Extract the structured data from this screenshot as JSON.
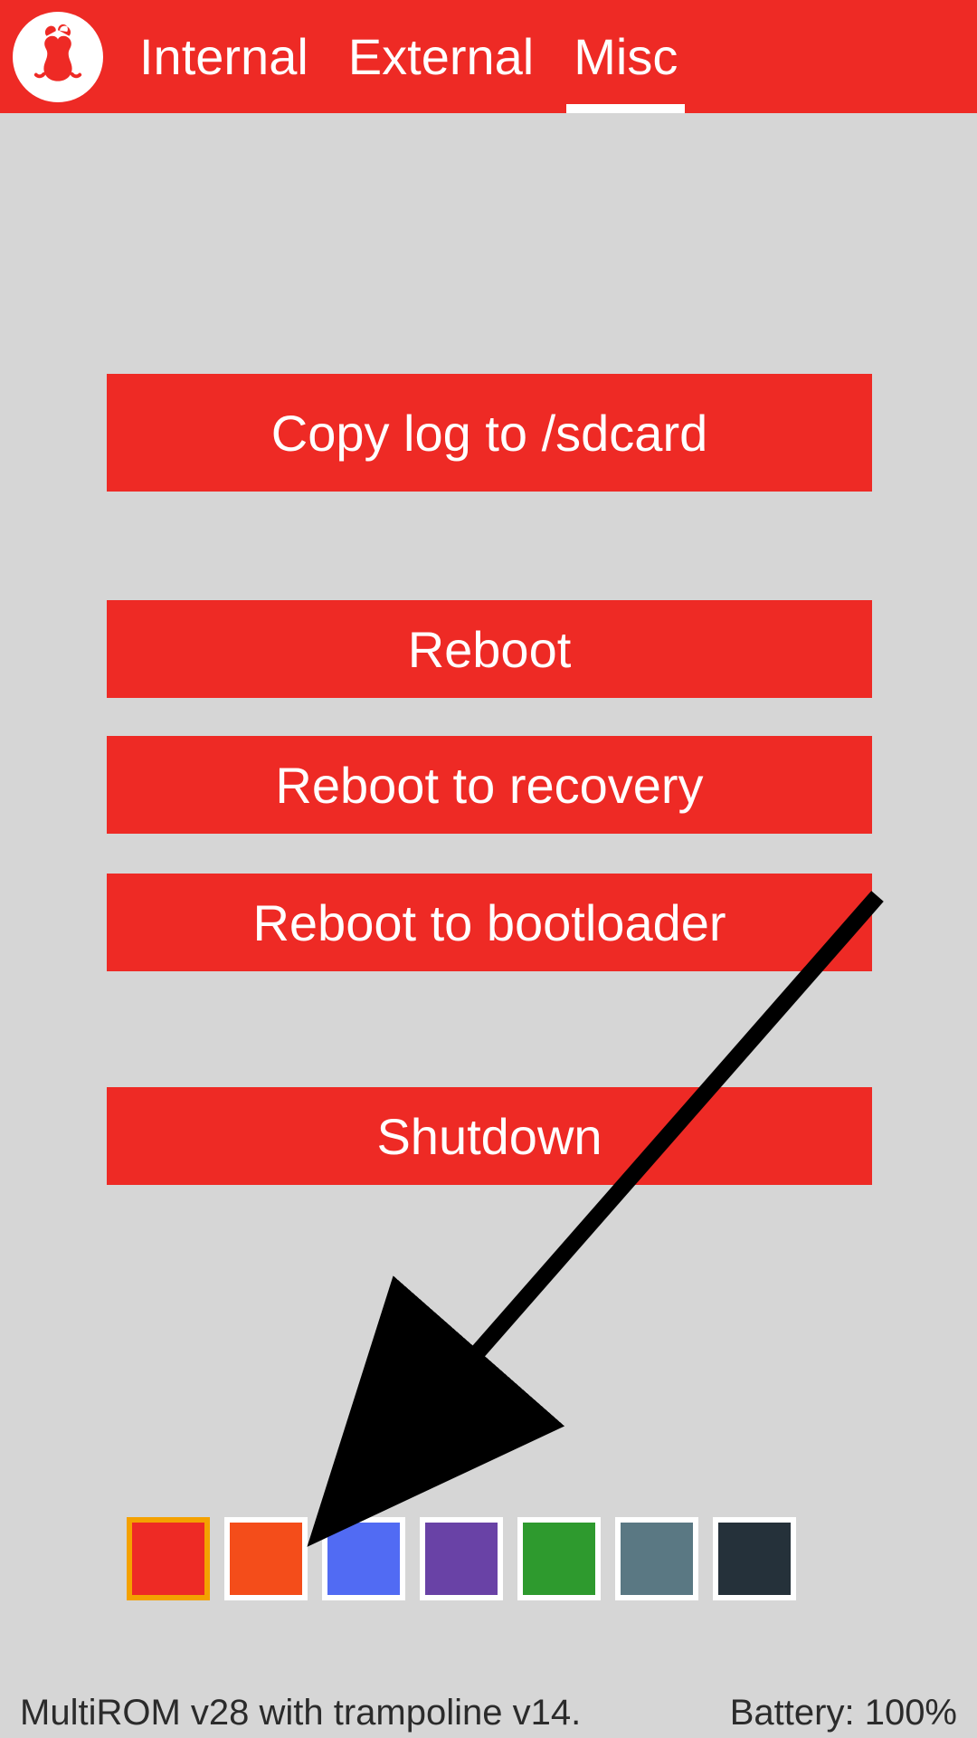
{
  "header": {
    "tabs": [
      {
        "label": "Internal",
        "active": false
      },
      {
        "label": "External",
        "active": false
      },
      {
        "label": "Misc",
        "active": true
      }
    ]
  },
  "buttons": {
    "copy_log": "Copy log to /sdcard",
    "reboot": "Reboot",
    "recovery": "Reboot to recovery",
    "bootloader": "Reboot to bootloader",
    "shutdown": "Shutdown"
  },
  "colors": [
    {
      "hex": "#ee2a25",
      "selected": true
    },
    {
      "hex": "#f44d1a",
      "selected": false
    },
    {
      "hex": "#516bf3",
      "selected": false
    },
    {
      "hex": "#6942a6",
      "selected": false
    },
    {
      "hex": "#2e9a2e",
      "selected": false
    },
    {
      "hex": "#5a7883",
      "selected": false
    },
    {
      "hex": "#25313a",
      "selected": false
    }
  ],
  "footer": {
    "version": "MultiROM v28 with trampoline v14.",
    "battery": "Battery: 100%"
  }
}
